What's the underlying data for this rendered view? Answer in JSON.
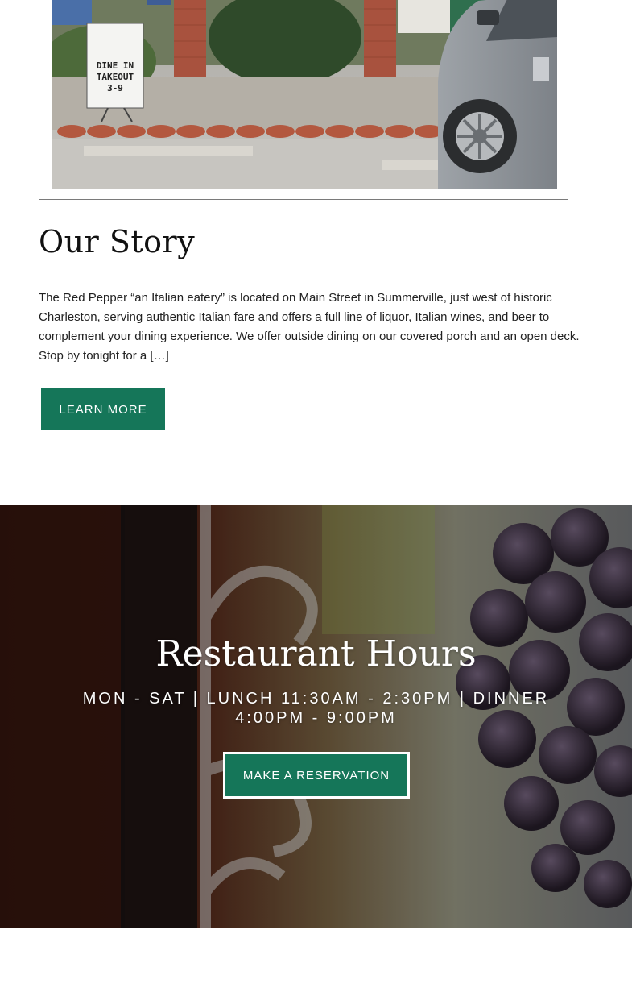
{
  "story": {
    "photo_sign": [
      "DINE IN",
      "TAKEOUT",
      "3-9"
    ],
    "title": "Our Story",
    "text": "The Red Pepper “an Italian eatery” is located on Main Street in Summerville, just west of historic Charleston, serving authentic Italian fare and offers a full line of liquor, Italian wines, and beer to complement your dining experience. We offer outside dining on our covered porch and an open deck. Stop by tonight for a […]",
    "button_label": "LEARN MORE"
  },
  "hours": {
    "title": "Restaurant Hours",
    "text": "MON - SAT | LUNCH 11:30AM - 2:30PM | DINNER 4:00PM - 9:00PM",
    "button_label": "MAKE A RESERVATION"
  },
  "colors": {
    "accent_green": "#157659",
    "text": "#222222",
    "white": "#ffffff"
  }
}
